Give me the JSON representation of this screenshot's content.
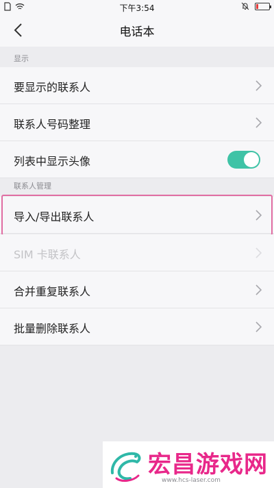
{
  "status_bar": {
    "time": "下午3:54"
  },
  "nav": {
    "title": "电话本"
  },
  "sections": {
    "display_header": "显示",
    "contacts_header": "联系人管理"
  },
  "rows": {
    "show_contacts": "要显示的联系人",
    "organize_numbers": "联系人号码整理",
    "show_avatar": "列表中显示头像",
    "import_export": "导入/导出联系人",
    "sim_contacts": "SIM 卡联系人",
    "merge_duplicates": "合并重复联系人",
    "batch_delete": "批量删除联系人"
  },
  "toggle_show_avatar": {
    "on": true
  },
  "accent_color": "#3fc3a6",
  "highlight_color": "#e06da2",
  "watermark": {
    "name": "宏昌游戏网",
    "url": "www.hcs-laser.com"
  }
}
